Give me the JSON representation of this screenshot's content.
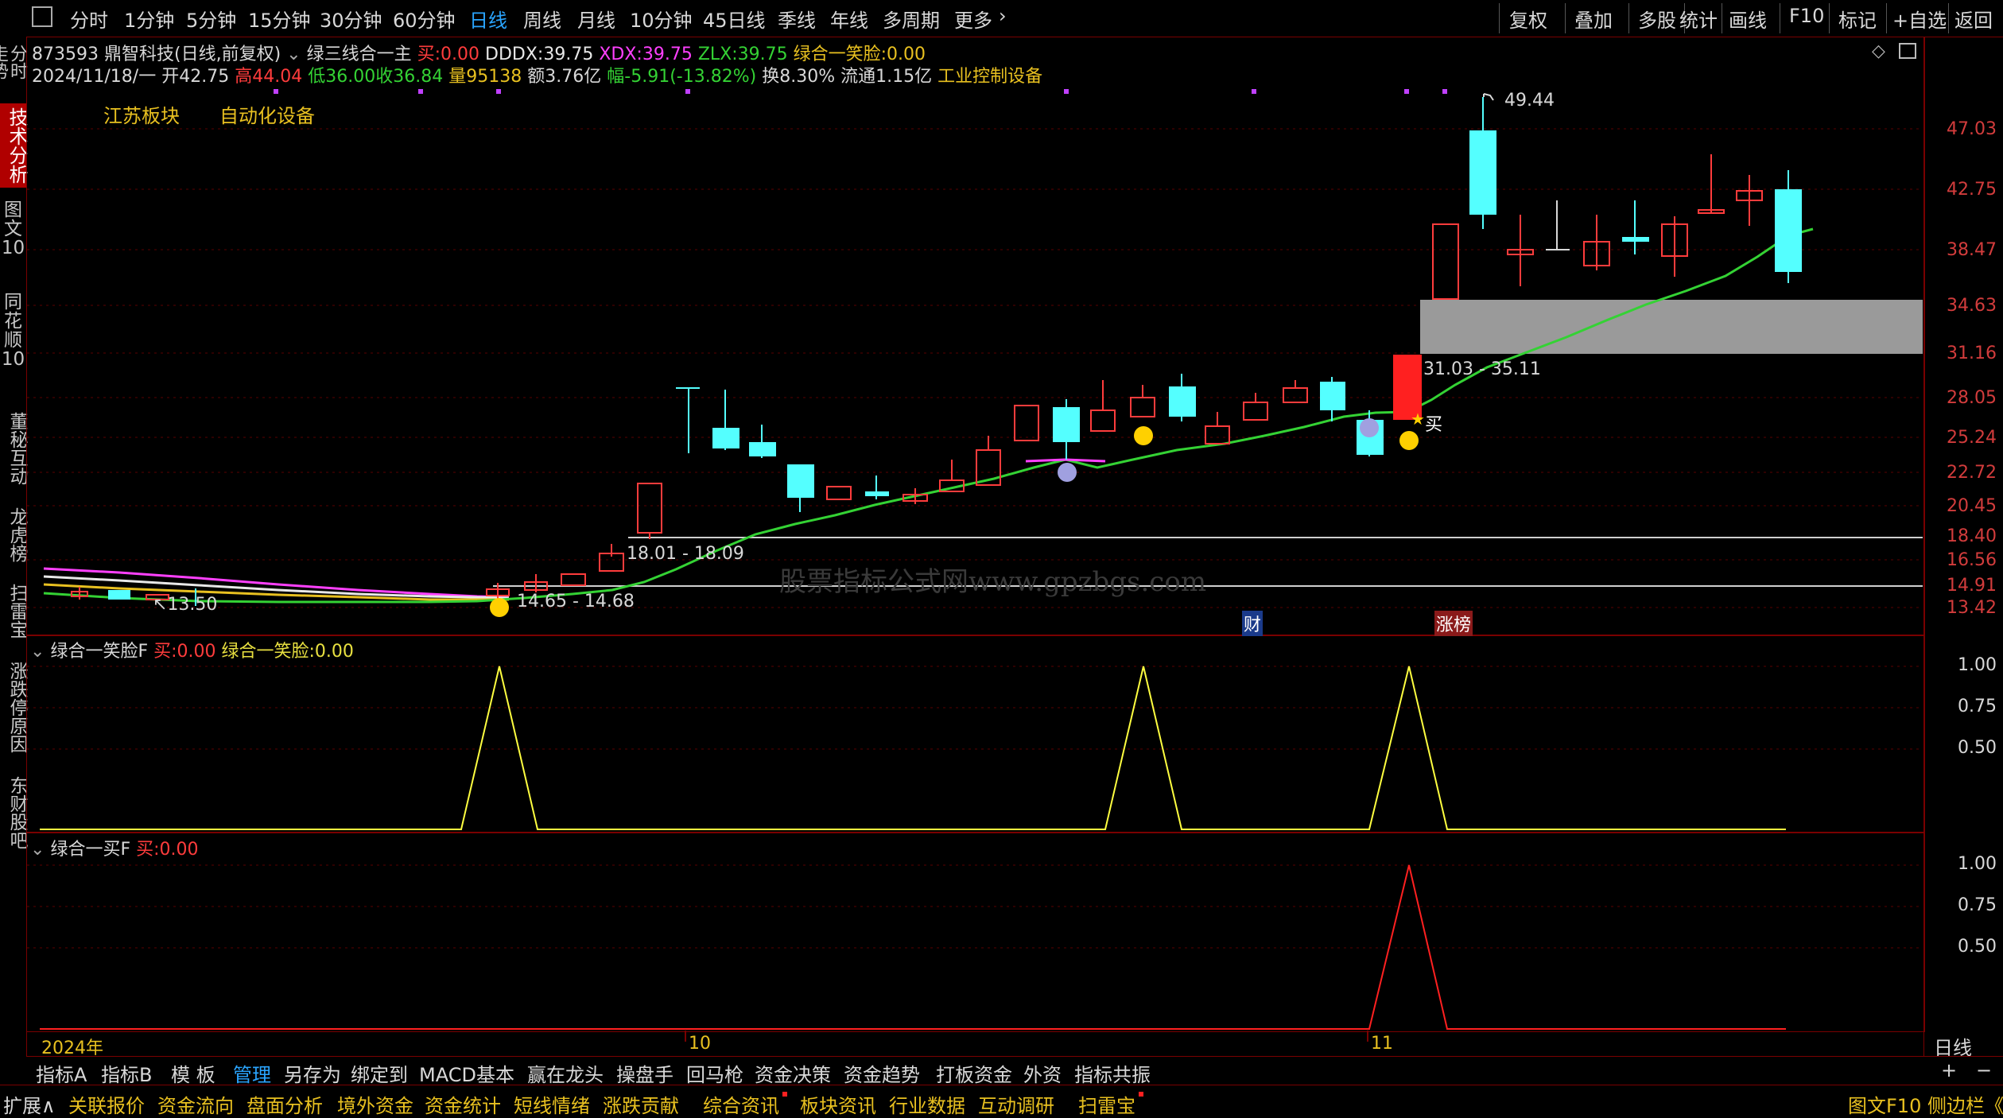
{
  "topbar": {
    "periods": [
      "分时",
      "1分钟",
      "5分钟",
      "15分钟",
      "30分钟",
      "60分钟",
      "日线",
      "周线",
      "月线",
      "10分钟",
      "45日线",
      "季线",
      "年线",
      "多周期",
      "更多"
    ],
    "active_period": "日线",
    "right_buttons": [
      "复权",
      "叠加",
      "多股",
      "统计",
      "画线",
      "F10",
      "标记",
      "+自选",
      "返回"
    ]
  },
  "sidebar": {
    "items": [
      "分时走势",
      "技术分析",
      "图文10",
      "同花顺10",
      "董秘互动",
      "龙虎榜",
      "扫雷宝",
      "涨跌停原因",
      "东财股吧"
    ],
    "active": "技术分析"
  },
  "stock": {
    "code": "873593",
    "name": "鼎智科技",
    "mode": "(日线,前复权)",
    "indicator": "绿三线合一主",
    "buy_label": "买:",
    "buy_value": "0.00",
    "dddx_label": "DDDX:",
    "dddx_value": "39.75",
    "xdx_label": "XDX:",
    "xdx_value": "39.75",
    "zlx_label": "ZLX:",
    "zlx_value": "39.75",
    "smile_label": "绿合一笑脸:",
    "smile_value": "0.00",
    "date": "2024/11/18/一",
    "open_label": "开",
    "open": "42.75",
    "high_label": "高",
    "high": "44.04",
    "low_label": "低",
    "low": "36.00",
    "close_label": "收",
    "close": "36.84",
    "volume_label": "量",
    "volume": "95138",
    "amount_label": "额",
    "amount": "3.76亿",
    "change_label": "幅",
    "change": "-5.91(-13.82%)",
    "turnover_label": "换",
    "turnover": "8.30%",
    "float_label": "流通",
    "float": "1.15亿",
    "industry": "工业控制设备",
    "tags": [
      "江苏板块",
      "自动化设备"
    ]
  },
  "price_axis": [
    "47.03",
    "42.75",
    "38.47",
    "34.63",
    "31.16",
    "28.05",
    "25.24",
    "22.72",
    "20.45",
    "18.40",
    "16.56",
    "14.91",
    "13.42"
  ],
  "annotations": {
    "high_mark": "49.44",
    "zone_label": "31.03 - 35.11",
    "level_1": "18.01 - 18.09",
    "level_2": "14.65 - 14.68",
    "low_mark": "13.50",
    "buy_text": "买",
    "badge_cai": "财",
    "badge_zhangbang": "涨榜"
  },
  "sub1": {
    "title": "绿合一笑脸F",
    "buy_label": "买:",
    "buy_value": "0.00",
    "smile_label": "绿合一笑脸:",
    "smile_value": "0.00",
    "axis": [
      "1.00",
      "0.75",
      "0.50"
    ]
  },
  "sub2": {
    "title": "绿合一买F",
    "buy_label": "买:",
    "buy_value": "0.00",
    "axis": [
      "1.00",
      "0.75",
      "0.50"
    ]
  },
  "time_axis": {
    "labels": [
      "2024年",
      "10",
      "11"
    ],
    "period": "日线"
  },
  "tabs1": [
    "指标A",
    "指标B",
    "模 板",
    "管理",
    "另存为",
    "绑定到",
    "MACD基本",
    "赢在龙头",
    "操盘手",
    "回马枪",
    "资金决策",
    "资金趋势",
    "打板资金",
    "外资",
    "指标共振"
  ],
  "tabs1_active": "管理",
  "tabs1_right": [
    "+",
    "−"
  ],
  "tabs2": [
    "扩展∧",
    "关联报价",
    "资金流向",
    "盘面分析",
    "境外资金",
    "资金统计",
    "短线情绪",
    "涨跌贡献",
    "综合资讯",
    "板块资讯",
    "行业数据",
    "互动调研",
    "扫雷宝"
  ],
  "tabs2_right": [
    "图文F10",
    "侧边栏《"
  ],
  "watermark": "股票指标公式网www.gpzbgs.com",
  "colors": {
    "up": "#ff3c3c",
    "down": "#54ffff",
    "ma": "#34d234",
    "grid": "#7a0000",
    "label_yellow": "#e8c020",
    "active_blue": "#2aa5ff"
  }
}
